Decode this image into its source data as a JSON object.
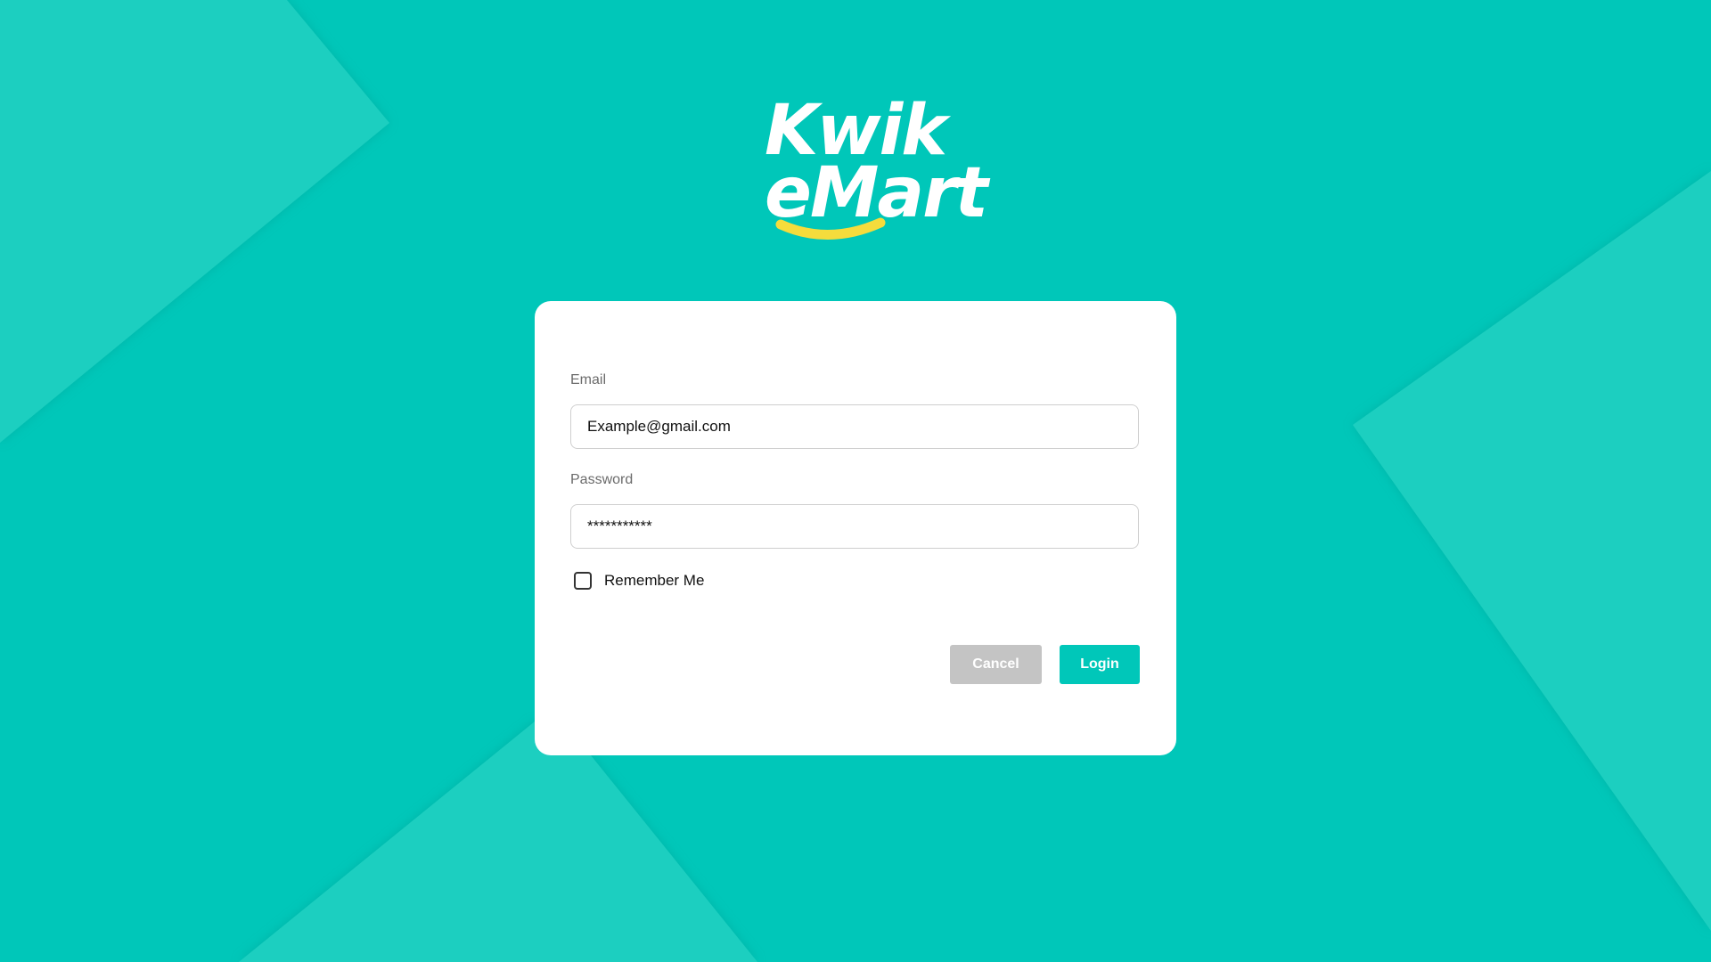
{
  "brand": {
    "name_line1": "Kwik",
    "name_line2": "eMart",
    "smile_color": "#f5dc3c",
    "background_color": "#00c7b9",
    "accent_color": "#00c7b9"
  },
  "login_form": {
    "email": {
      "label": "Email",
      "value": "Example@gmail.com"
    },
    "password": {
      "label": "Password",
      "value": "***********"
    },
    "remember_me": {
      "label": "Remember Me",
      "checked": false
    },
    "buttons": {
      "cancel": "Cancel",
      "login": "Login"
    }
  }
}
